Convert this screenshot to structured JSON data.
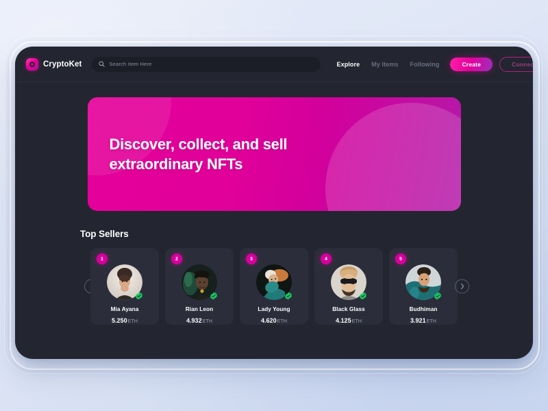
{
  "brand": {
    "name": "CryptoKet",
    "logo_icon": "cryptoket-logo-icon",
    "accent": "#e5009b"
  },
  "search": {
    "placeholder": "Search Item Here",
    "value": "",
    "icon": "search-icon"
  },
  "nav": {
    "items": [
      {
        "label": "Explore",
        "active": true
      },
      {
        "label": "My Items",
        "active": false
      },
      {
        "label": "Following",
        "active": false
      }
    ]
  },
  "actions": {
    "create_label": "Create",
    "connect_label": "Connect"
  },
  "hero": {
    "title_line1": "Discover, collect, and sell",
    "title_line2": "extraordinary NFTs",
    "gradient_from": "#e5009b",
    "gradient_to": "#b41aa8"
  },
  "top_sellers": {
    "title": "Top Sellers",
    "prev_icon": "chevron-left-icon",
    "next_icon": "chevron-right-icon",
    "currency": "ETH",
    "sellers": [
      {
        "rank": "1",
        "name": "Mia Ayana",
        "price": "5.250",
        "unit": "ETH",
        "verified": true,
        "avatar": "portrait-woman-light"
      },
      {
        "rank": "2",
        "name": "Rian Leon",
        "price": "4.932",
        "unit": "ETH",
        "verified": true,
        "avatar": "portrait-man-hat"
      },
      {
        "rank": "3",
        "name": "Lady Young",
        "price": "4.620",
        "unit": "ETH",
        "verified": true,
        "avatar": "portrait-woman-teal"
      },
      {
        "rank": "4",
        "name": "Black Glass",
        "price": "4.125",
        "unit": "ETH",
        "verified": true,
        "avatar": "portrait-man-sunglasses"
      },
      {
        "rank": "5",
        "name": "Budhiman",
        "price": "3.921",
        "unit": "ETH",
        "verified": true,
        "avatar": "portrait-man-teal-shirt"
      }
    ]
  }
}
